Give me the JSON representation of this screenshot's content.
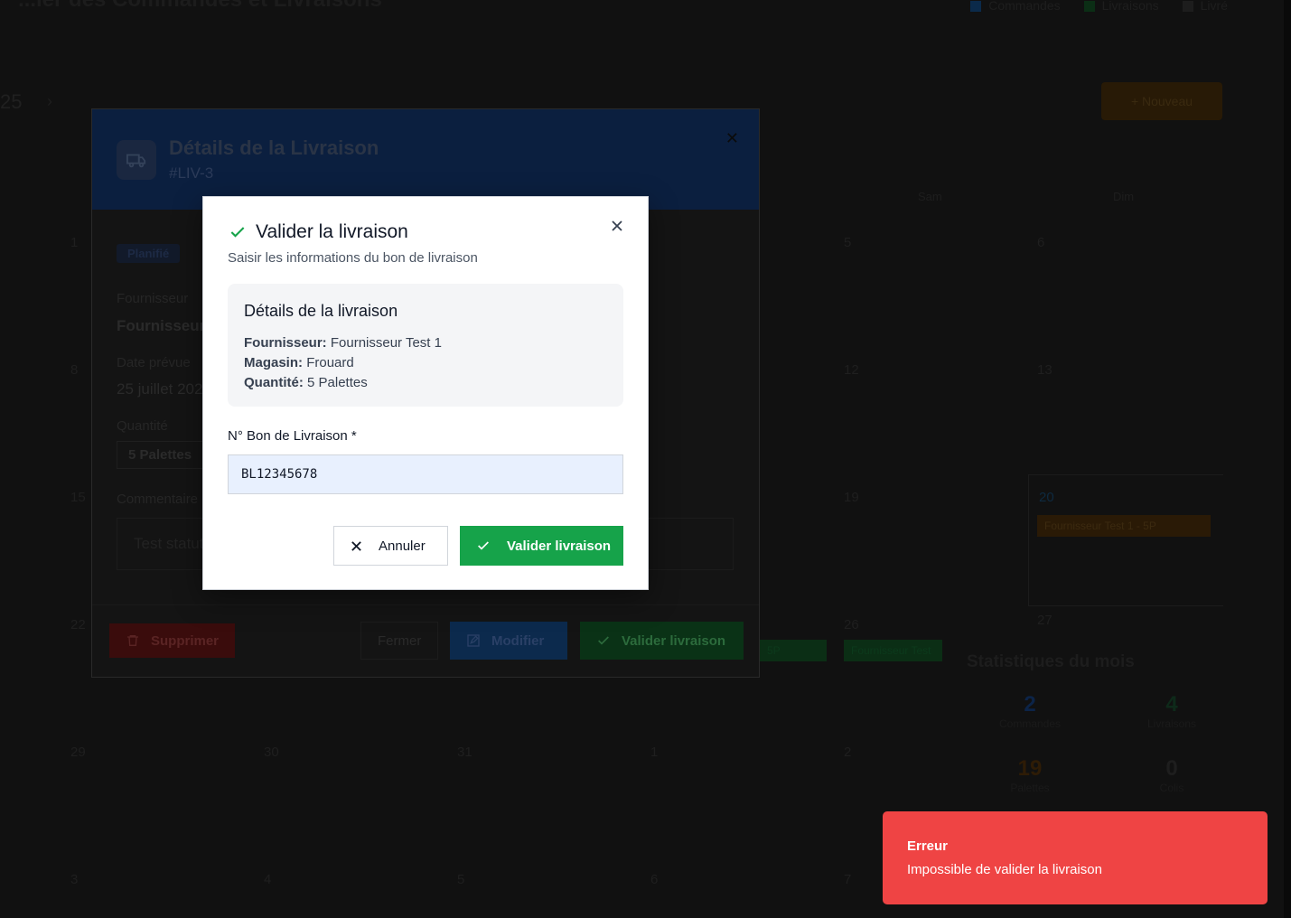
{
  "background": {
    "page_title": "...ier des Commandes et Livraisons",
    "legend": [
      {
        "label": "Commandes",
        "color": "#0b2a4a"
      },
      {
        "label": "Livraisons",
        "color": "#0b2e15"
      },
      {
        "label": "Livré",
        "color": "#1d1d1d"
      }
    ],
    "year_fragment": "25",
    "next_label": "›",
    "new_button": "+ Nouveau",
    "weekdays": [
      "Sam",
      "Dim"
    ],
    "days": [
      "1",
      "5",
      "6",
      "8",
      "12",
      "13",
      "15",
      "19",
      "20",
      "22",
      "26",
      "27",
      "29",
      "30",
      "31",
      "1",
      "2",
      "3",
      "4",
      "5",
      "6",
      "7"
    ],
    "events": [
      "Fournisseur Test 1 - 5P",
      "Fournisseur Test",
      "5P"
    ],
    "stats": {
      "title": "Statistiques du mois",
      "items": [
        {
          "value": "2",
          "label": "Commandes",
          "color": "#0c2448"
        },
        {
          "value": "4",
          "label": "Livraisons",
          "color": "#0e2a1a"
        },
        {
          "value": "19",
          "label": "Palettes",
          "color": "#2e1c06"
        },
        {
          "value": "0",
          "label": "Colis",
          "color": "#1e1e1e"
        }
      ]
    }
  },
  "details_modal": {
    "title": "Détails de la Livraison",
    "subtitle": "#LIV-3",
    "status": "Planifié",
    "supplier_label": "Fournisseur",
    "supplier_value": "Fournisseur",
    "date_label": "Date prévue",
    "date_value": "25 juillet 202",
    "quantity_label": "Quantité",
    "quantity_value": "5 Palettes",
    "comment_label": "Commentaire",
    "comment_value": "Test statut",
    "buttons": {
      "delete": "Supprimer",
      "close": "Fermer",
      "edit": "Modifier",
      "validate": "Valider livraison"
    }
  },
  "dialog": {
    "title": "Valider la livraison",
    "subtitle": "Saisir les informations du bon de livraison",
    "card_title": "Détails de la livraison",
    "supplier_key": "Fournisseur:",
    "supplier_value": "Fournisseur Test 1",
    "store_key": "Magasin:",
    "store_value": "Frouard",
    "quantity_key": "Quantité:",
    "quantity_value": "5 Palettes",
    "field_label": "N° Bon de Livraison *",
    "field_value": "BL12345678",
    "cancel_label": "Annuler",
    "confirm_label": "Valider livraison",
    "accent": "#16a34a"
  },
  "toast": {
    "title": "Erreur",
    "message": "Impossible de valider la livraison",
    "color": "#ef4444"
  }
}
